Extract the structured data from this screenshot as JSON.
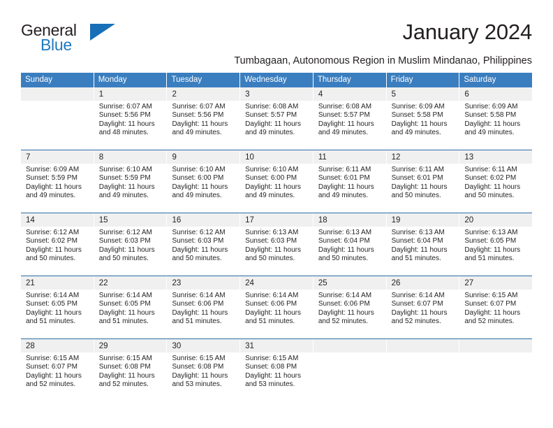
{
  "brand": {
    "line1": "General",
    "line2": "Blue",
    "triangle_icon": "blue-triangle-logo-mark",
    "color_text": "#231f20",
    "color_blue": "#1f7ac0"
  },
  "header": {
    "month_title": "January 2024",
    "location": "Tumbagaan, Autonomous Region in Muslim Mindanao, Philippines"
  },
  "theme": {
    "header_blue": "#3a7ebf",
    "row_divider_blue": "#2e6da4",
    "day_number_band": "#f0f0f0",
    "text": "#231f20"
  },
  "day_headers": [
    "Sunday",
    "Monday",
    "Tuesday",
    "Wednesday",
    "Thursday",
    "Friday",
    "Saturday"
  ],
  "weeks": [
    [
      {
        "day": "",
        "empty": true
      },
      {
        "day": "1",
        "sunrise": "Sunrise: 6:07 AM",
        "sunset": "Sunset: 5:56 PM",
        "daylight1": "Daylight: 11 hours",
        "daylight2": "and 48 minutes."
      },
      {
        "day": "2",
        "sunrise": "Sunrise: 6:07 AM",
        "sunset": "Sunset: 5:56 PM",
        "daylight1": "Daylight: 11 hours",
        "daylight2": "and 49 minutes."
      },
      {
        "day": "3",
        "sunrise": "Sunrise: 6:08 AM",
        "sunset": "Sunset: 5:57 PM",
        "daylight1": "Daylight: 11 hours",
        "daylight2": "and 49 minutes."
      },
      {
        "day": "4",
        "sunrise": "Sunrise: 6:08 AM",
        "sunset": "Sunset: 5:57 PM",
        "daylight1": "Daylight: 11 hours",
        "daylight2": "and 49 minutes."
      },
      {
        "day": "5",
        "sunrise": "Sunrise: 6:09 AM",
        "sunset": "Sunset: 5:58 PM",
        "daylight1": "Daylight: 11 hours",
        "daylight2": "and 49 minutes."
      },
      {
        "day": "6",
        "sunrise": "Sunrise: 6:09 AM",
        "sunset": "Sunset: 5:58 PM",
        "daylight1": "Daylight: 11 hours",
        "daylight2": "and 49 minutes."
      }
    ],
    [
      {
        "day": "7",
        "sunrise": "Sunrise: 6:09 AM",
        "sunset": "Sunset: 5:59 PM",
        "daylight1": "Daylight: 11 hours",
        "daylight2": "and 49 minutes."
      },
      {
        "day": "8",
        "sunrise": "Sunrise: 6:10 AM",
        "sunset": "Sunset: 5:59 PM",
        "daylight1": "Daylight: 11 hours",
        "daylight2": "and 49 minutes."
      },
      {
        "day": "9",
        "sunrise": "Sunrise: 6:10 AM",
        "sunset": "Sunset: 6:00 PM",
        "daylight1": "Daylight: 11 hours",
        "daylight2": "and 49 minutes."
      },
      {
        "day": "10",
        "sunrise": "Sunrise: 6:10 AM",
        "sunset": "Sunset: 6:00 PM",
        "daylight1": "Daylight: 11 hours",
        "daylight2": "and 49 minutes."
      },
      {
        "day": "11",
        "sunrise": "Sunrise: 6:11 AM",
        "sunset": "Sunset: 6:01 PM",
        "daylight1": "Daylight: 11 hours",
        "daylight2": "and 49 minutes."
      },
      {
        "day": "12",
        "sunrise": "Sunrise: 6:11 AM",
        "sunset": "Sunset: 6:01 PM",
        "daylight1": "Daylight: 11 hours",
        "daylight2": "and 50 minutes."
      },
      {
        "day": "13",
        "sunrise": "Sunrise: 6:11 AM",
        "sunset": "Sunset: 6:02 PM",
        "daylight1": "Daylight: 11 hours",
        "daylight2": "and 50 minutes."
      }
    ],
    [
      {
        "day": "14",
        "sunrise": "Sunrise: 6:12 AM",
        "sunset": "Sunset: 6:02 PM",
        "daylight1": "Daylight: 11 hours",
        "daylight2": "and 50 minutes."
      },
      {
        "day": "15",
        "sunrise": "Sunrise: 6:12 AM",
        "sunset": "Sunset: 6:03 PM",
        "daylight1": "Daylight: 11 hours",
        "daylight2": "and 50 minutes."
      },
      {
        "day": "16",
        "sunrise": "Sunrise: 6:12 AM",
        "sunset": "Sunset: 6:03 PM",
        "daylight1": "Daylight: 11 hours",
        "daylight2": "and 50 minutes."
      },
      {
        "day": "17",
        "sunrise": "Sunrise: 6:13 AM",
        "sunset": "Sunset: 6:03 PM",
        "daylight1": "Daylight: 11 hours",
        "daylight2": "and 50 minutes."
      },
      {
        "day": "18",
        "sunrise": "Sunrise: 6:13 AM",
        "sunset": "Sunset: 6:04 PM",
        "daylight1": "Daylight: 11 hours",
        "daylight2": "and 50 minutes."
      },
      {
        "day": "19",
        "sunrise": "Sunrise: 6:13 AM",
        "sunset": "Sunset: 6:04 PM",
        "daylight1": "Daylight: 11 hours",
        "daylight2": "and 51 minutes."
      },
      {
        "day": "20",
        "sunrise": "Sunrise: 6:13 AM",
        "sunset": "Sunset: 6:05 PM",
        "daylight1": "Daylight: 11 hours",
        "daylight2": "and 51 minutes."
      }
    ],
    [
      {
        "day": "21",
        "sunrise": "Sunrise: 6:14 AM",
        "sunset": "Sunset: 6:05 PM",
        "daylight1": "Daylight: 11 hours",
        "daylight2": "and 51 minutes."
      },
      {
        "day": "22",
        "sunrise": "Sunrise: 6:14 AM",
        "sunset": "Sunset: 6:05 PM",
        "daylight1": "Daylight: 11 hours",
        "daylight2": "and 51 minutes."
      },
      {
        "day": "23",
        "sunrise": "Sunrise: 6:14 AM",
        "sunset": "Sunset: 6:06 PM",
        "daylight1": "Daylight: 11 hours",
        "daylight2": "and 51 minutes."
      },
      {
        "day": "24",
        "sunrise": "Sunrise: 6:14 AM",
        "sunset": "Sunset: 6:06 PM",
        "daylight1": "Daylight: 11 hours",
        "daylight2": "and 51 minutes."
      },
      {
        "day": "25",
        "sunrise": "Sunrise: 6:14 AM",
        "sunset": "Sunset: 6:06 PM",
        "daylight1": "Daylight: 11 hours",
        "daylight2": "and 52 minutes."
      },
      {
        "day": "26",
        "sunrise": "Sunrise: 6:14 AM",
        "sunset": "Sunset: 6:07 PM",
        "daylight1": "Daylight: 11 hours",
        "daylight2": "and 52 minutes."
      },
      {
        "day": "27",
        "sunrise": "Sunrise: 6:15 AM",
        "sunset": "Sunset: 6:07 PM",
        "daylight1": "Daylight: 11 hours",
        "daylight2": "and 52 minutes."
      }
    ],
    [
      {
        "day": "28",
        "sunrise": "Sunrise: 6:15 AM",
        "sunset": "Sunset: 6:07 PM",
        "daylight1": "Daylight: 11 hours",
        "daylight2": "and 52 minutes."
      },
      {
        "day": "29",
        "sunrise": "Sunrise: 6:15 AM",
        "sunset": "Sunset: 6:08 PM",
        "daylight1": "Daylight: 11 hours",
        "daylight2": "and 52 minutes."
      },
      {
        "day": "30",
        "sunrise": "Sunrise: 6:15 AM",
        "sunset": "Sunset: 6:08 PM",
        "daylight1": "Daylight: 11 hours",
        "daylight2": "and 53 minutes."
      },
      {
        "day": "31",
        "sunrise": "Sunrise: 6:15 AM",
        "sunset": "Sunset: 6:08 PM",
        "daylight1": "Daylight: 11 hours",
        "daylight2": "and 53 minutes."
      },
      {
        "day": "",
        "empty": true
      },
      {
        "day": "",
        "empty": true
      },
      {
        "day": "",
        "empty": true
      }
    ]
  ]
}
